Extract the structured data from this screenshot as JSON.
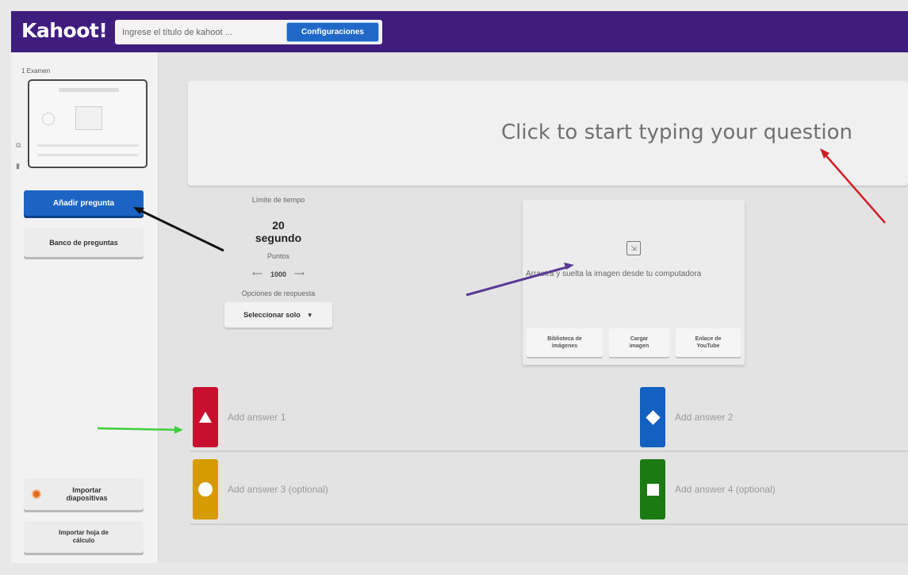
{
  "header": {
    "logo": "Kahoot!",
    "title_placeholder": "Ingrese el título de kahoot ...",
    "config_label": "Configuraciones"
  },
  "sidebar": {
    "slide_label": "1 Examen",
    "add_question_label": "Añadir pregunta",
    "question_bank_label": "Banco de preguntas",
    "import_slides_label": "Importar\ndiapositivas",
    "import_sheet_label": "Importar hoja de\ncálculo"
  },
  "question": {
    "placeholder": "Click to start typing your question"
  },
  "settings": {
    "time_limit_label": "Límite de tiempo",
    "time_value": "20",
    "time_unit": "segundo",
    "points_label": "Puntos",
    "points_value": "1000",
    "answer_options_label": "Opciones de respuesta",
    "select_label": "Seleccionar solo"
  },
  "media": {
    "drop_text": "Arrastra y suelta la imagen desde tu computadora",
    "buttons": [
      "Biblioteca de\nimágenes",
      "Cargar\nimagen",
      "Enlace de\nYouTube"
    ]
  },
  "answers": [
    {
      "label": "Add answer 1",
      "color": "#c8102e",
      "shape": "triangle-icon"
    },
    {
      "label": "Add answer 2",
      "color": "#1260c0",
      "shape": "diamond-icon"
    },
    {
      "label": "Add answer 3 (optional)",
      "color": "#d59b00",
      "shape": "circle-icon"
    },
    {
      "label": "Add answer 4 (optional)",
      "color": "#1b7a12",
      "shape": "square-icon"
    }
  ],
  "annotations": {
    "arrow_colors": [
      "#111111",
      "#d21f26",
      "#5b3a96",
      "#3ecf3e"
    ]
  }
}
